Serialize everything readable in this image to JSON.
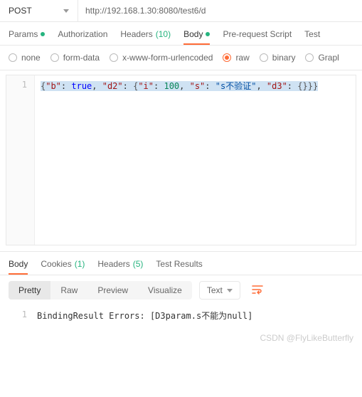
{
  "method": "POST",
  "url": "http://192.168.1.30:8080/test6/d",
  "requestTabs": {
    "params": "Params",
    "authorization": "Authorization",
    "headers": "Headers",
    "headersCount": "(10)",
    "body": "Body",
    "prerequest": "Pre-request Script",
    "tests": "Test"
  },
  "bodyTypes": {
    "none": "none",
    "formData": "form-data",
    "urlencoded": "x-www-form-urlencoded",
    "raw": "raw",
    "binary": "binary",
    "graphql": "Grapl"
  },
  "requestBody": {
    "line": "1",
    "json": {
      "open": "{",
      "k_b": "\"b\"",
      "v_b": "true",
      "sep1": ", ",
      "k_d2": "\"d2\"",
      "d2_open": "{",
      "k_i": "\"i\"",
      "v_i": "100",
      "sep2": ", ",
      "k_s": "\"s\"",
      "v_s": "\"s不验证\"",
      "sep3": ", ",
      "k_d3": "\"d3\"",
      "v_d3": "{}",
      "d2_close": "}",
      "close": "}"
    }
  },
  "responseTabs": {
    "body": "Body",
    "cookies": "Cookies",
    "cookiesCount": "(1)",
    "headers": "Headers",
    "headersCount": "(5)",
    "testResults": "Test Results"
  },
  "viewModes": {
    "pretty": "Pretty",
    "raw": "Raw",
    "preview": "Preview",
    "visualize": "Visualize"
  },
  "responseType": "Text",
  "responseBody": {
    "line": "1",
    "text": "BindingResult Errors: [D3param.s不能为null]"
  },
  "watermark": "CSDN @FlyLikeButterfly",
  "colors": {
    "accent": "#ff6c37",
    "green": "#26b47f"
  }
}
